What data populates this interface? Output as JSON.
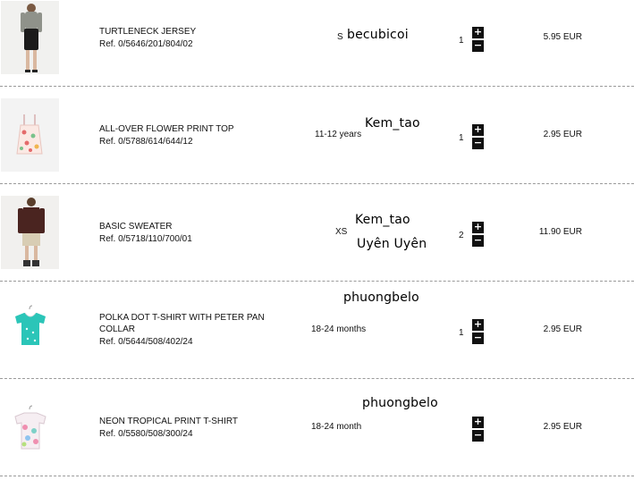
{
  "items": [
    {
      "name": "TURTLENECK JERSEY",
      "ref": "Ref. 0/5646/201/804/02",
      "size": "S",
      "notes": [
        "becubicoi"
      ],
      "qty": "1",
      "price": "5.95 EUR"
    },
    {
      "name": "ALL-OVER FLOWER PRINT TOP",
      "ref": "Ref. 0/5788/614/644/12",
      "size": "11-12 years",
      "notes": [
        "Kem_tao"
      ],
      "qty": "1",
      "price": "2.95 EUR"
    },
    {
      "name": "BASIC SWEATER",
      "ref": "Ref. 0/5718/110/700/01",
      "size": "XS",
      "notes": [
        "Kem_tao",
        "Uyên Uyên"
      ],
      "qty": "2",
      "price": "11.90 EUR"
    },
    {
      "name_line1": "POLKA DOT T-SHIRT WITH PETER PAN",
      "name_line2": "COLLAR",
      "ref": "Ref. 0/5644/508/402/24",
      "size": "18-24 months",
      "notes": [
        "phuongbelo"
      ],
      "qty": "1",
      "price": "2.95 EUR"
    },
    {
      "name": "NEON TROPICAL PRINT T-SHIRT",
      "ref": "Ref. 0/5580/508/300/24",
      "size": "18-24 month",
      "notes": [
        "phuongbelo"
      ],
      "qty": "",
      "price": "2.95 EUR"
    }
  ],
  "controls": {
    "plus": "+",
    "minus": "−"
  }
}
